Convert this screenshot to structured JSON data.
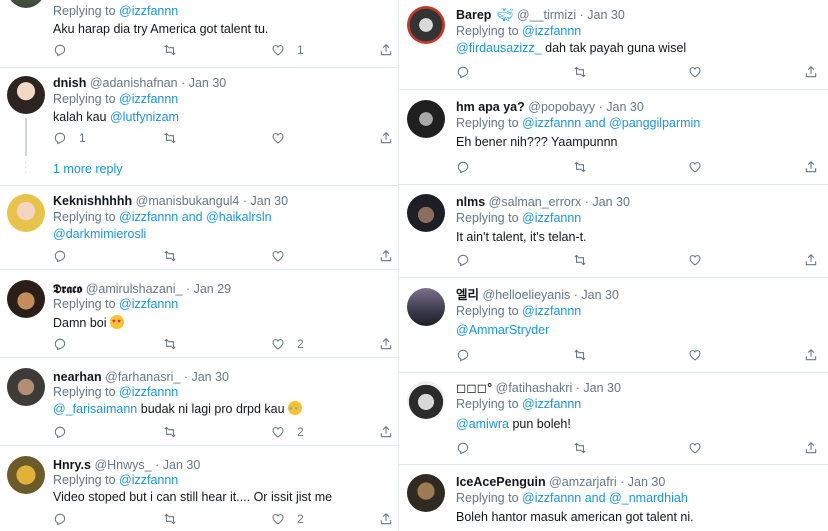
{
  "left": [
    {
      "replying_prefix": "Replying to ",
      "replying_to": "@izzfannn",
      "text": "Aku harap dia try America got talent tu.",
      "reply_count": "",
      "like_count": "1"
    },
    {
      "name": "dnish",
      "handle": "@adanishafnan",
      "date": "· Jan 30",
      "replying_prefix": "Replying to ",
      "replying_to": "@izzfannn",
      "text_plain": "kalah kau ",
      "text_mention": "@lutfynizam",
      "reply_count": "1",
      "like_count": "",
      "more_reply": "1 more reply"
    },
    {
      "name": "Keknishhhhh",
      "handle": "@manisbukangul4",
      "date": "· Jan 30",
      "replying_prefix": "Replying to ",
      "replying_to": "@izzfannn and @haikalrsln",
      "text_mention": "@darkmimierosli",
      "reply_count": "",
      "like_count": ""
    },
    {
      "name": "𝕯𝖗𝖆𝖈𝖔",
      "handle": "@amirulshazani_",
      "date": "· Jan 29",
      "replying_prefix": "Replying to ",
      "replying_to": "@izzfannn",
      "text": "Damn boi",
      "emoji": "heart-eyes",
      "reply_count": "",
      "like_count": "2"
    },
    {
      "name": "nearhan",
      "handle": "@farhanasri_",
      "date": "· Jan 30",
      "replying_prefix": "Replying to ",
      "replying_to": "@izzfannn",
      "text_mention": "@_farisaimann",
      "text_plain": " budak ni lagi pro drpd kau",
      "emoji": "tears-of-joy",
      "reply_count": "",
      "like_count": "2"
    },
    {
      "name": "Hnry.s",
      "handle": "@Hnwys_",
      "date": "· Jan 30",
      "replying_prefix": "Replying to ",
      "replying_to": "@izzfannn",
      "text": "Video stoped but i can still hear it.... Or issit jist me",
      "reply_count": "",
      "like_count": "2"
    }
  ],
  "right": [
    {
      "name": "Barep",
      "badge": "whale",
      "handle": "@__tirmizi",
      "date": "· Jan 30",
      "replying_prefix": "Replying to ",
      "replying_to": "@izzfannn",
      "text_mention": "@firdausazizz_",
      "text_plain": " dah tak payah guna wisel"
    },
    {
      "name": "hm apa ya?",
      "handle": "@popobayy",
      "date": "· Jan 30",
      "replying_prefix": "Replying to ",
      "replying_to": "@izzfannn and @panggilparmin",
      "text": "Eh bener nih??? Yaampunnn"
    },
    {
      "name": "nlms",
      "handle": "@salman_errorx",
      "date": "· Jan 30",
      "replying_prefix": "Replying to ",
      "replying_to": "@izzfannn",
      "text": "It ain't talent, it's telan-t."
    },
    {
      "name": "엘리",
      "handle": "@helloelieyanis",
      "date": "· Jan 30",
      "replying_prefix": "Replying to ",
      "replying_to": "@izzfannn",
      "text_mention": "@AmmarStryder"
    },
    {
      "name": "◻◻◻°",
      "handle": "@fatihashakri",
      "date": "· Jan 30",
      "replying_prefix": "Replying to ",
      "replying_to": "@izzfannn",
      "text_mention": "@amiwra",
      "text_plain": " pun boleh!"
    },
    {
      "name": "IceAcePenguin",
      "handle": "@amzarjafri",
      "date": "· Jan 30",
      "replying_prefix": "Replying to ",
      "replying_to": "@izzfannn and @_nmardhiah",
      "text": "Boleh hantor masuk american got talent ni."
    }
  ],
  "colors": {
    "link": "#1b95e0",
    "muted": "#657786",
    "border": "#e1e8ed"
  }
}
